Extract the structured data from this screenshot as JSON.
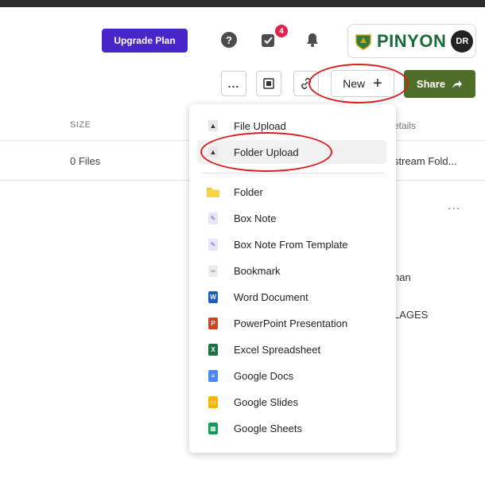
{
  "header": {
    "upgrade_label": "Upgrade Plan",
    "tasks_badge": "4",
    "brand_name": "PINYON",
    "avatar_initials": "DR"
  },
  "toolbar": {
    "more_label": "...",
    "new_label": "New",
    "new_plus": "+",
    "share_label": "Share"
  },
  "list": {
    "col_size": "SIZE",
    "col_details": "etails",
    "row_size": "0 Files",
    "row_details": "stream Fold...",
    "bg_more": "...",
    "bg_text_1": "nan",
    "bg_text_2": "LAGES",
    "bg_text_3": ""
  },
  "menu": {
    "upload_items": [
      {
        "label": "File Upload",
        "icon": "upload-icon"
      },
      {
        "label": "Folder Upload",
        "icon": "upload-icon"
      }
    ],
    "create_items": [
      {
        "label": "Folder",
        "icon": "folder-icon",
        "color": "#f5d547"
      },
      {
        "label": "Box Note",
        "icon": "box-note-icon",
        "color": "#b9c0e8"
      },
      {
        "label": "Box Note From Template",
        "icon": "box-note-template-icon",
        "color": "#b9c0e8"
      },
      {
        "label": "Bookmark",
        "icon": "bookmark-icon",
        "color": "#cfcfcf"
      },
      {
        "label": "Word Document",
        "icon": "word-icon",
        "color": "#1e5fb8"
      },
      {
        "label": "PowerPoint Presentation",
        "icon": "powerpoint-icon",
        "color": "#d04423"
      },
      {
        "label": "Excel Spreadsheet",
        "icon": "excel-icon",
        "color": "#1d7044"
      },
      {
        "label": "Google Docs",
        "icon": "google-docs-icon",
        "color": "#4c86f5"
      },
      {
        "label": "Google Slides",
        "icon": "google-slides-icon",
        "color": "#f4b400"
      },
      {
        "label": "Google Sheets",
        "icon": "google-sheets-icon",
        "color": "#0f9d58"
      }
    ]
  },
  "colors": {
    "upgrade": "#4826c9",
    "share": "#4f6e2a",
    "badge": "#e0234e",
    "annotation": "#d81f1f"
  }
}
